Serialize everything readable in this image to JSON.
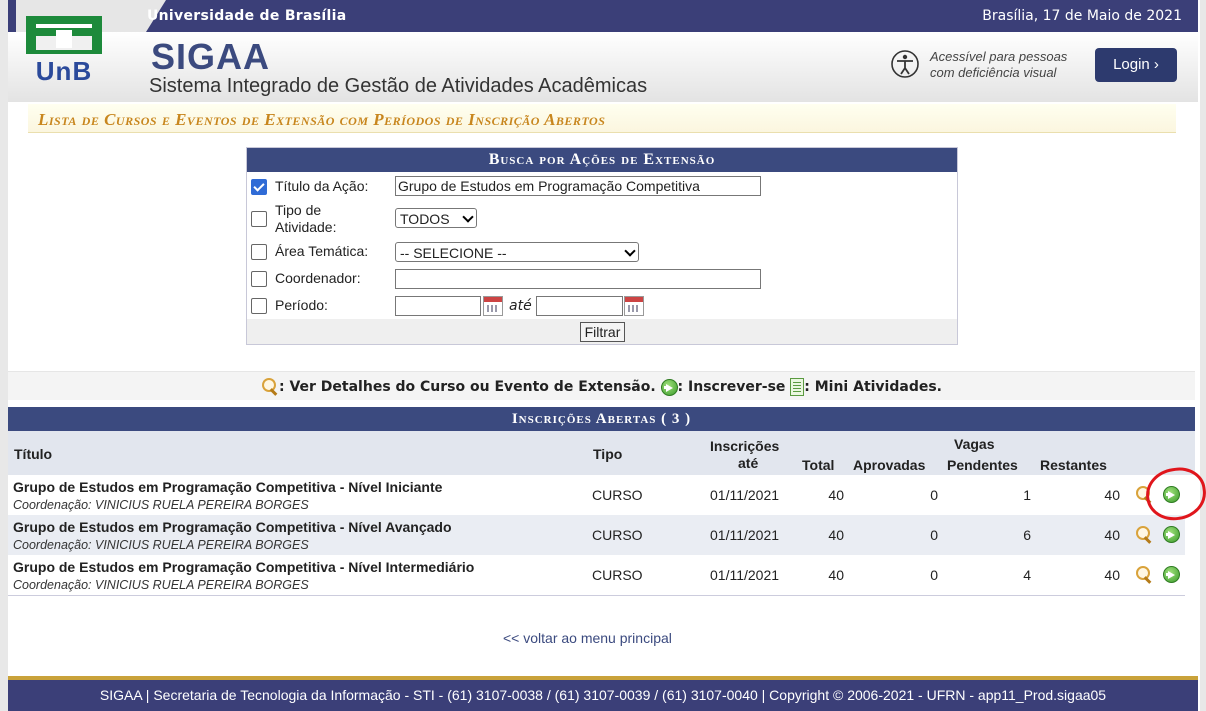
{
  "topbar": {
    "university": "Universidade de Brasília",
    "date": "Brasília, 17 de Maio de 2021"
  },
  "header": {
    "logo_text": "UnB",
    "system_name": "SIGAA",
    "system_full": "Sistema Integrado de Gestão de Atividades Acadêmicas",
    "accessibility_line1": "Acessível para pessoas",
    "accessibility_line2": "com deficiência visual",
    "login_label": "Login  ›"
  },
  "page_title": "Lista de Cursos e Eventos de Extensão com Períodos de Inscrição Abertos",
  "search": {
    "caption": "Busca por Ações de Extensão",
    "titulo_label": "Título da Ação:",
    "titulo_checked": true,
    "titulo_value": "Grupo de Estudos em Programação Competitiva",
    "tipo_label_1": "Tipo de",
    "tipo_label_2": "Atividade:",
    "tipo_value": "TODOS",
    "area_label": "Área Temática:",
    "area_value": "-- SELECIONE --",
    "coord_label": "Coordenador:",
    "coord_value": "",
    "periodo_label": "Período:",
    "periodo_start": "",
    "periodo_end": "",
    "ate": "até",
    "filter_label": "Filtrar"
  },
  "legend": {
    "ver_detalhes": ": Ver Detalhes do Curso ou Evento de Extensão.",
    "inscrever": ": Inscrever-se",
    "mini": ": Mini Atividades."
  },
  "table": {
    "caption": "Inscrições Abertas ( 3 )",
    "headers": {
      "titulo": "Título",
      "tipo": "Tipo",
      "inscricoes": "Inscrições",
      "ate": "até",
      "vagas": "Vagas",
      "total": "Total",
      "aprovadas": "Aprovadas",
      "pendentes": "Pendentes",
      "restantes": "Restantes"
    },
    "rows": [
      {
        "titulo": "Grupo de Estudos em Programação Competitiva - Nível Iniciante",
        "coordenacao": "Coordenação: VINICIUS RUELA PEREIRA BORGES",
        "tipo": "CURSO",
        "ate": "01/11/2021",
        "total": "40",
        "aprovadas": "0",
        "pendentes": "1",
        "restantes": "40"
      },
      {
        "titulo": "Grupo de Estudos em Programação Competitiva - Nível Avançado",
        "coordenacao": "Coordenação: VINICIUS RUELA PEREIRA BORGES",
        "tipo": "CURSO",
        "ate": "01/11/2021",
        "total": "40",
        "aprovadas": "0",
        "pendentes": "6",
        "restantes": "40"
      },
      {
        "titulo": "Grupo de Estudos em Programação Competitiva - Nível Intermediário",
        "coordenacao": "Coordenação: VINICIUS RUELA PEREIRA BORGES",
        "tipo": "CURSO",
        "ate": "01/11/2021",
        "total": "40",
        "aprovadas": "0",
        "pendentes": "4",
        "restantes": "40"
      }
    ]
  },
  "back_link": "<< voltar ao menu principal",
  "footer": "SIGAA | Secretaria de Tecnologia da Informação - STI - (61) 3107-0038 / (61) 3107-0039 / (61) 3107-0040 | Copyright © 2006-2021 - UFRN - app11_Prod.sigaa05",
  "colors": {
    "navy": "#3b4a7f",
    "gold": "#c8861e",
    "annotation": "#e0161c"
  }
}
